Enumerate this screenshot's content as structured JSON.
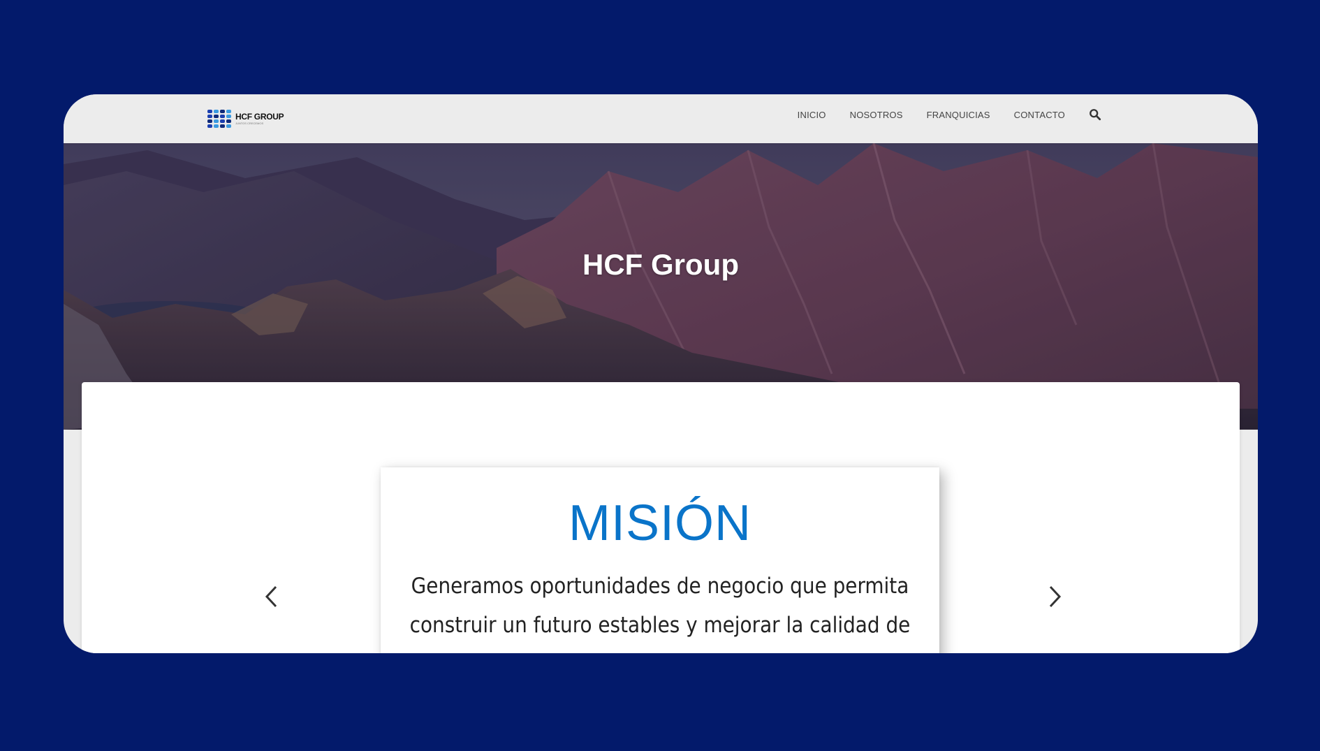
{
  "brand": {
    "name": "HCF GROUP",
    "tagline": "JUNTOS CRECEMOS"
  },
  "nav": {
    "items": [
      {
        "label": "INICIO"
      },
      {
        "label": "NOSOTROS"
      },
      {
        "label": "FRANQUICIAS"
      },
      {
        "label": "CONTACTO"
      }
    ],
    "search_icon": "search-icon"
  },
  "hero": {
    "title": "HCF Group"
  },
  "carousel": {
    "prev_icon": "chevron-left-icon",
    "next_icon": "chevron-right-icon",
    "slide": {
      "title": "MISIÓN",
      "text": "Generamos oportunidades de negocio que permita construir un futuro estables y mejorar la calidad de"
    }
  },
  "colors": {
    "background": "#031a6b",
    "nav_bg": "#ececec",
    "accent": "#0a74c9",
    "hero_overlay": "#3a3358"
  }
}
